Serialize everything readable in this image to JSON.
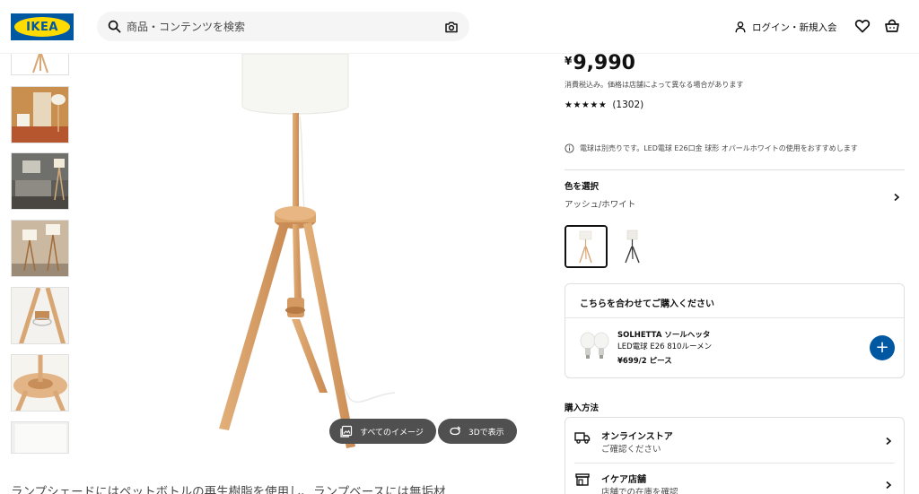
{
  "header": {
    "logo_text": "IKEA",
    "search_placeholder": "商品・コンテンツを検索",
    "login_label": "ログイン・新規入会",
    "brand_blue": "#0058a3",
    "brand_yellow": "#ffdb00"
  },
  "gallery": {
    "all_images_label": "すべてのイメージ",
    "view_3d_label": "3Dで表示"
  },
  "description": "ランプシェードにはペットボトルの再生樹脂を使用し、ランプベースには無垢材",
  "product": {
    "price_symbol": "¥",
    "price_value": "9,990",
    "tax_note": "消費税込み。価格は店舗によって異なる場合があります",
    "stars": "★★★★★",
    "rating_value": 5,
    "review_count": "(1302)",
    "bulb_note": "電球は別売りです。LED電球 E26口金 球形 オパールホワイトの使用をおすすめします"
  },
  "color": {
    "title": "色を選択",
    "value": "アッシュ/ホワイト"
  },
  "combo": {
    "title": "こちらを合わせてご購入ください",
    "name": "SOLHETTA ソールヘッタ",
    "desc": "LED電球 E26 810ルーメン",
    "price": "¥699/2 ピース",
    "add_symbol": "+"
  },
  "purchase": {
    "title": "購入方法",
    "online_label": "オンラインストア",
    "online_sub": "ご確認ください",
    "store_label": "イケア店舗",
    "store_sub": "店舗での在庫を確認"
  }
}
